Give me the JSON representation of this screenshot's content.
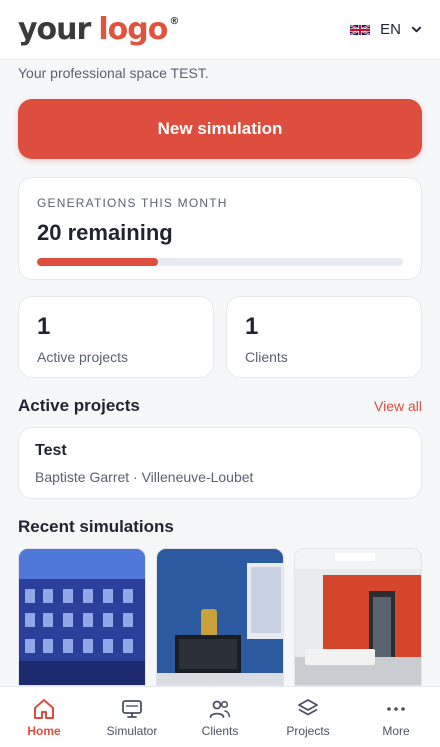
{
  "header": {
    "logo_part1": "your",
    "logo_part2": "logo",
    "logo_reg": "®",
    "language": "EN"
  },
  "subtitle": "Your professional space TEST.",
  "new_simulation_label": "New simulation",
  "generations": {
    "label": "GENERATIONS THIS MONTH",
    "value_text": "20 remaining",
    "progress_fraction": 0.33
  },
  "stats": [
    {
      "value": "1",
      "label": "Active projects"
    },
    {
      "value": "1",
      "label": "Clients"
    }
  ],
  "active_projects": {
    "title": "Active projects",
    "view_all": "View all",
    "items": [
      {
        "name": "Test",
        "meta": "Baptiste Garret · Villeneuve-Loubet"
      }
    ]
  },
  "recent_simulations": {
    "title": "Recent simulations"
  },
  "nav": [
    {
      "label": "Home",
      "icon": "home-icon",
      "active": true
    },
    {
      "label": "Simulator",
      "icon": "monitor-icon",
      "active": false
    },
    {
      "label": "Clients",
      "icon": "users-icon",
      "active": false
    },
    {
      "label": "Projects",
      "icon": "layers-icon",
      "active": false
    },
    {
      "label": "More",
      "icon": "more-dots-icon",
      "active": false
    }
  ],
  "colors": {
    "accent": "#dd4e3e",
    "background": "#f6f7f9",
    "card": "#ffffff"
  }
}
